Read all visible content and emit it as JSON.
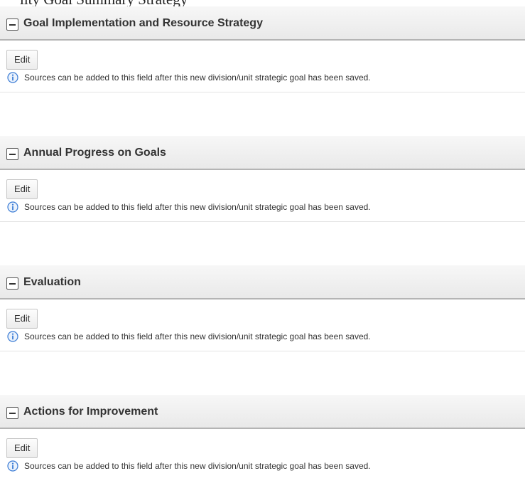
{
  "page_title": "lity Goal Summary Strategy",
  "sections": [
    {
      "title": "Goal Implementation and Resource Strategy",
      "edit_label": "Edit",
      "info_text": "Sources can be added to this field after this new division/unit strategic goal has been saved."
    },
    {
      "title": "Annual Progress on Goals",
      "edit_label": "Edit",
      "info_text": "Sources can be added to this field after this new division/unit strategic goal has been saved."
    },
    {
      "title": "Evaluation",
      "edit_label": "Edit",
      "info_text": "Sources can be added to this field after this new division/unit strategic goal has been saved."
    },
    {
      "title": "Actions for Improvement",
      "edit_label": "Edit",
      "info_text": "Sources can be added to this field after this new division/unit strategic goal has been saved."
    }
  ],
  "icons": {
    "toggle": "collapse-minus-icon",
    "info": "info-icon"
  },
  "colors": {
    "header_background": "#efefef",
    "header_border": "#b4b4b4",
    "info_icon": "#3a7bd5",
    "text": "#333333"
  }
}
